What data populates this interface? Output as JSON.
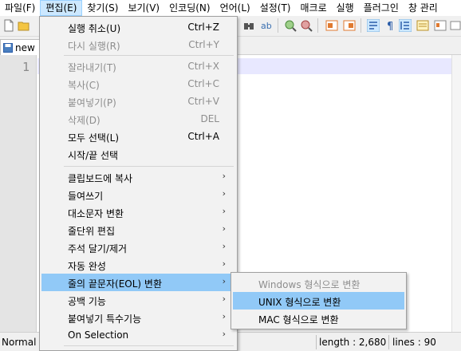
{
  "menubar": {
    "items": [
      {
        "label": "파일(F)"
      },
      {
        "label": "편집(E)"
      },
      {
        "label": "찾기(S)"
      },
      {
        "label": "보기(V)"
      },
      {
        "label": "인코딩(N)"
      },
      {
        "label": "언어(L)"
      },
      {
        "label": "설정(T)"
      },
      {
        "label": "매크로"
      },
      {
        "label": "실행"
      },
      {
        "label": "플러그인"
      },
      {
        "label": "창 관리"
      }
    ]
  },
  "tab": {
    "label": "new"
  },
  "editor": {
    "line_number": "1"
  },
  "statusbar": {
    "mode": "Normal te",
    "length": "length : 2,680",
    "lines": "lines : 90"
  },
  "edit_menu": {
    "items": [
      {
        "label": "실행 취소(U)",
        "shortcut": "Ctrl+Z",
        "enabled": true
      },
      {
        "label": "다시 실행(R)",
        "shortcut": "Ctrl+Y",
        "enabled": false
      },
      {
        "label": "잘라내기(T)",
        "shortcut": "Ctrl+X",
        "enabled": false
      },
      {
        "label": "복사(C)",
        "shortcut": "Ctrl+C",
        "enabled": false
      },
      {
        "label": "붙여넣기(P)",
        "shortcut": "Ctrl+V",
        "enabled": false
      },
      {
        "label": "삭제(D)",
        "shortcut": "DEL",
        "enabled": false
      },
      {
        "label": "모두 선택(L)",
        "shortcut": "Ctrl+A",
        "enabled": true
      },
      {
        "label": "시작/끝 선택",
        "shortcut": "",
        "enabled": true
      },
      {
        "label": "클립보드에 복사",
        "enabled": true
      },
      {
        "label": "들여쓰기",
        "enabled": true
      },
      {
        "label": "대소문자 변환",
        "enabled": true
      },
      {
        "label": "줄단위 편집",
        "enabled": true
      },
      {
        "label": "주석 달기/제거",
        "enabled": true
      },
      {
        "label": "자동 완성",
        "enabled": true
      },
      {
        "label": "줄의 끝문자(EOL) 변환",
        "enabled": true,
        "highlighted": true
      },
      {
        "label": "공백 기능",
        "enabled": true
      },
      {
        "label": "붙여넣기 특수기능",
        "enabled": true
      },
      {
        "label": "On Selection",
        "enabled": true
      }
    ],
    "submenu_arrow": "›"
  },
  "eol_submenu": {
    "items": [
      {
        "label": "Windows 형식으로 변환",
        "enabled": false
      },
      {
        "label": "UNIX 형식으로 변환",
        "enabled": true,
        "highlighted": true
      },
      {
        "label": "MAC 형식으로 변환",
        "enabled": true
      }
    ]
  },
  "colors": {
    "highlight": "#91c9f7",
    "menu_active": "#cce8ff",
    "disabled_text": "#8d8d8d",
    "current_line": "#e8e8ff"
  }
}
